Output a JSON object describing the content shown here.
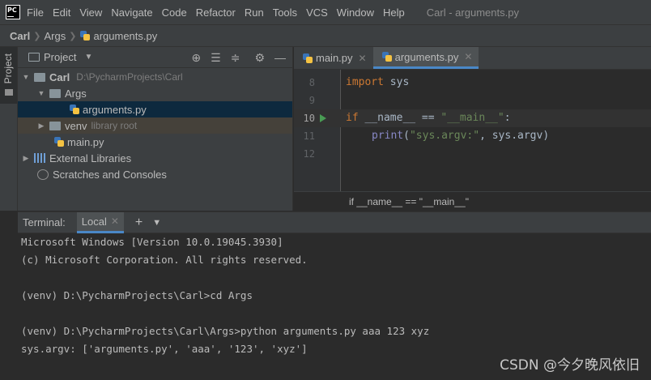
{
  "menubar": {
    "logo_text_top": "PC",
    "items": [
      "File",
      "Edit",
      "View",
      "Navigate",
      "Code",
      "Refactor",
      "Run",
      "Tools",
      "VCS",
      "Window",
      "Help"
    ],
    "window_title": "Carl - arguments.py"
  },
  "breadcrumb": {
    "project": "Carl",
    "folder": "Args",
    "file": "arguments.py"
  },
  "sidebar_strip": {
    "project_tab": "Project"
  },
  "project_panel": {
    "title": "Project",
    "tree": {
      "root_label": "Carl",
      "root_path": "D:\\PycharmProjects\\Carl",
      "args_folder": "Args",
      "arguments_file": "arguments.py",
      "venv_folder": "venv",
      "venv_hint": "library root",
      "main_file": "main.py",
      "external_libraries": "External Libraries",
      "scratches": "Scratches and Consoles"
    }
  },
  "editor": {
    "tabs": [
      {
        "label": "main.py"
      },
      {
        "label": "arguments.py"
      }
    ],
    "line_numbers": [
      "8",
      "9",
      "10",
      "11",
      "12"
    ],
    "code": {
      "line8_kw": "import",
      "line8_rest": " sys",
      "line10_kw": "if",
      "line10_mid": " __name__ == ",
      "line10_str": "\"__main__\"",
      "line10_end": ":",
      "line11_fn": "print",
      "line11_open": "(",
      "line11_str": "\"sys.argv:\"",
      "line11_rest": ", sys.argv)"
    },
    "status": "if __name__ == \"__main__\""
  },
  "terminal": {
    "label": "Terminal:",
    "tab": "Local",
    "lines": [
      "Microsoft Windows [Version 10.0.19045.3930]",
      "(c) Microsoft Corporation. All rights reserved.",
      "",
      "(venv) D:\\PycharmProjects\\Carl>cd Args",
      "",
      "(venv) D:\\PycharmProjects\\Carl\\Args>python arguments.py aaa 123 xyz",
      "sys.argv: ['arguments.py', 'aaa', '123', 'xyz']"
    ],
    "watermark": "CSDN @今夕晚风依旧"
  }
}
